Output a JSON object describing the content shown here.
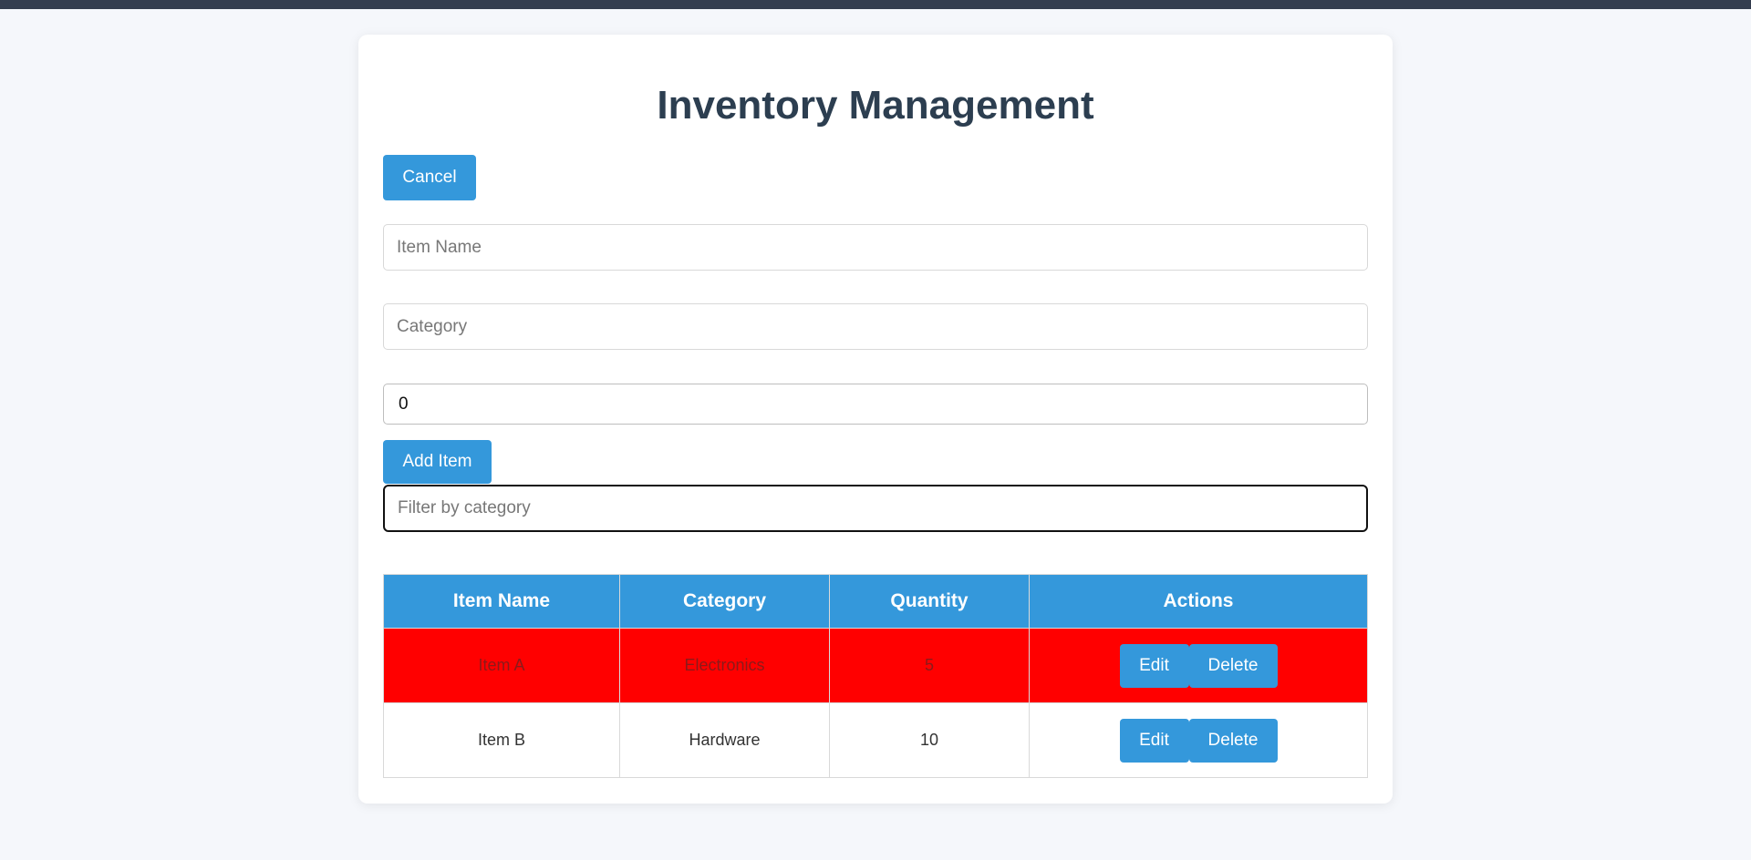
{
  "title": "Inventory Management",
  "buttons": {
    "cancel": "Cancel",
    "add_item": "Add Item"
  },
  "form": {
    "item_name_placeholder": "Item Name",
    "item_name_value": "",
    "category_placeholder": "Category",
    "category_value": "",
    "quantity_value": "0",
    "filter_placeholder": "Filter by category",
    "filter_value": ""
  },
  "table": {
    "headers": [
      "Item Name",
      "Category",
      "Quantity",
      "Actions"
    ],
    "rows": [
      {
        "name": "Item A",
        "category": "Electronics",
        "quantity": "5",
        "edit": "Edit",
        "delete": "Delete",
        "highlighted": true
      },
      {
        "name": "Item B",
        "category": "Hardware",
        "quantity": "10",
        "edit": "Edit",
        "delete": "Delete",
        "highlighted": false
      }
    ]
  },
  "colors": {
    "accent": "#3498db",
    "highlight_row": "#ff0000",
    "title": "#2c3e50",
    "top_bar": "#343d4f"
  }
}
